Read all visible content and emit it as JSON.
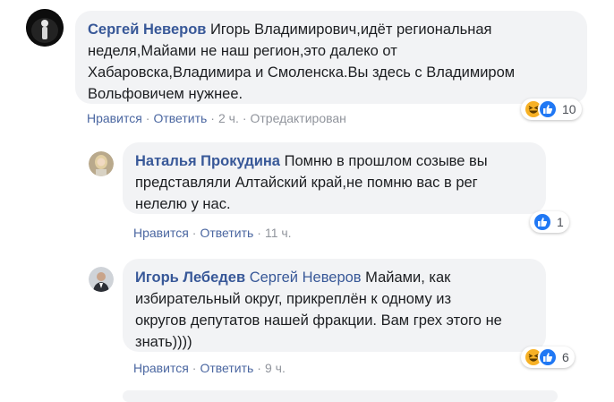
{
  "comments": [
    {
      "author": "Сергей Неверов",
      "text_lines": [
        " Игорь Владимирович,идёт региональная",
        "неделя,Майами не наш регион,это далеко от",
        "Хабаровска,Владимира и Смоленска.Вы здесь с Владимиром",
        "Вольфовичем нужнее."
      ],
      "actions": {
        "like": "Нравится",
        "reply": "Ответить",
        "time": "2 ч.",
        "edited": "Отредактирован"
      },
      "reactions": {
        "count": "10",
        "icons": [
          "haha-icon",
          "like-icon"
        ]
      }
    },
    {
      "author": "Наталья Прокудина",
      "text_lines": [
        " Помню в прошлом созыве вы",
        "представляли Алтайский край,не помню вас в рег",
        "нелелю у нас."
      ],
      "actions": {
        "like": "Нравится",
        "reply": "Ответить",
        "time": "11 ч."
      },
      "reactions": {
        "count": "1",
        "icons": [
          "like-icon"
        ]
      }
    },
    {
      "author": "Игорь Лебедев",
      "mention": "Сергей Неверов",
      "text_lines": [
        " Майами, как",
        "избирательный округ, прикреплён к одному из",
        "округов депутатов нашей фракции. Вам грех этого не",
        "знать))))"
      ],
      "actions": {
        "like": "Нравится",
        "reply": "Ответить",
        "time": "9 ч."
      },
      "reactions": {
        "count": "6",
        "icons": [
          "haha-icon",
          "like-icon"
        ]
      }
    }
  ],
  "colors": {
    "link": "#385898",
    "bubble": "#f2f3f5",
    "like": "#2078f4",
    "haha": "#f7b125",
    "meta": "#90949c"
  }
}
